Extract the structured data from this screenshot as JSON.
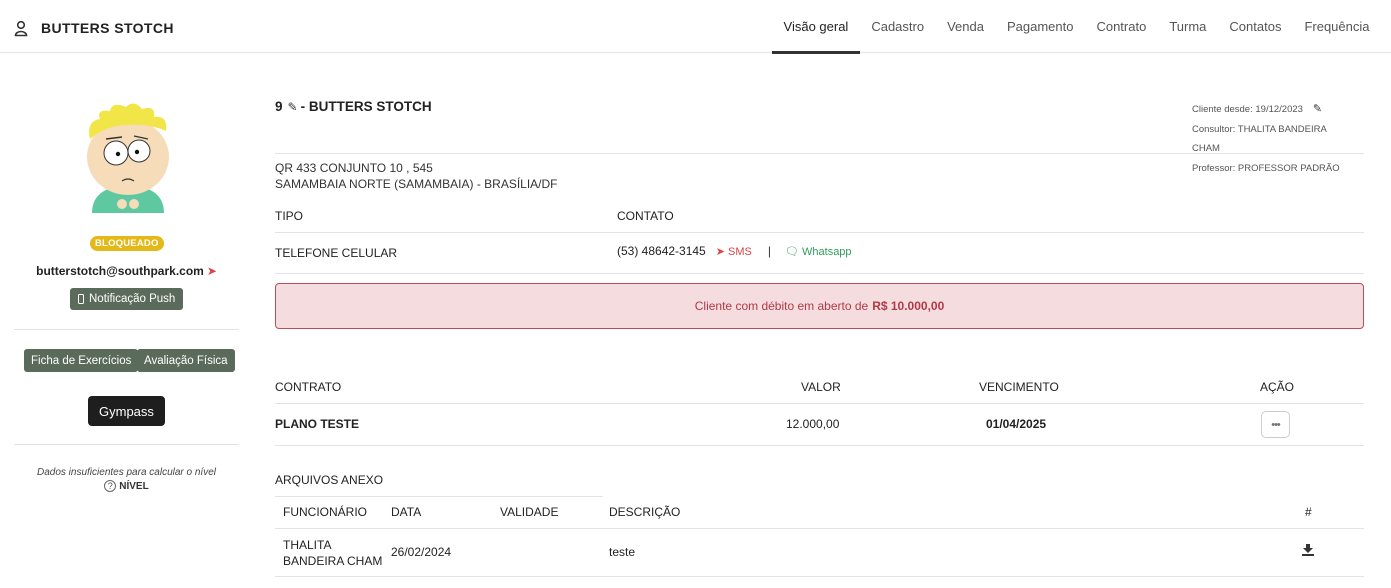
{
  "header": {
    "client_name": "BUTTERS STOTCH",
    "tabs": [
      "Visão geral",
      "Cadastro",
      "Venda",
      "Pagamento",
      "Contrato",
      "Turma",
      "Contatos",
      "Frequência"
    ],
    "active_tab": "Visão geral"
  },
  "sidebar": {
    "status_badge": "BLOQUEADO",
    "email": "butterstotch@southpark.com",
    "push_button": "Notificação Push",
    "ficha_button": "Ficha de Exercícios",
    "avaliacao_button": "Avaliação Física",
    "gympass_button": "Gympass",
    "nivel_note": "Dados insuficientes para calcular o nível",
    "nivel_label": "NÍVEL"
  },
  "client": {
    "id": "9",
    "title_sep": "- BUTTERS STOTCH",
    "since": "Cliente desde: 19/12/2023",
    "consultor": "Consultor: THALITA BANDEIRA CHAM",
    "professor": "Professor: PROFESSOR PADRÃO",
    "address_line1": "QR 433 CONJUNTO 10 , 545",
    "address_line2": "SAMAMBAIA NORTE (SAMAMBAIA) - BRASÍLIA/DF"
  },
  "contacts": {
    "header_tipo": "TIPO",
    "header_contato": "CONTATO",
    "tipo": "TELEFONE CELULAR",
    "phone": "(53) 48642-3145",
    "sms": "SMS",
    "whatsapp": "Whatsapp"
  },
  "alert": {
    "text": "Cliente com débito em aberto de",
    "amount": "R$ 10.000,00"
  },
  "contracts": {
    "headers": [
      "CONTRATO",
      "VALOR",
      "VENCIMENTO",
      "AÇÃO"
    ],
    "row": {
      "contrato": "PLANO TESTE",
      "valor": "12.000,00",
      "vencimento": "01/04/2025"
    }
  },
  "attachments": {
    "title": "ARQUIVOS ANEXO",
    "headers": [
      "FUNCIONÁRIO",
      "DATA",
      "VALIDADE",
      "DESCRIÇÃO",
      "#"
    ],
    "row": {
      "funcionario_line1": "THALITA",
      "funcionario_line2": "BANDEIRA CHAM",
      "data": "26/02/2024",
      "validade": "",
      "descricao": "teste"
    }
  },
  "colors": {
    "alert_bg": "#f5dcdf",
    "alert_border": "#b4505c",
    "badge": "#e5b81a",
    "sms": "#d94545",
    "whatsapp": "#2e9e5b"
  }
}
